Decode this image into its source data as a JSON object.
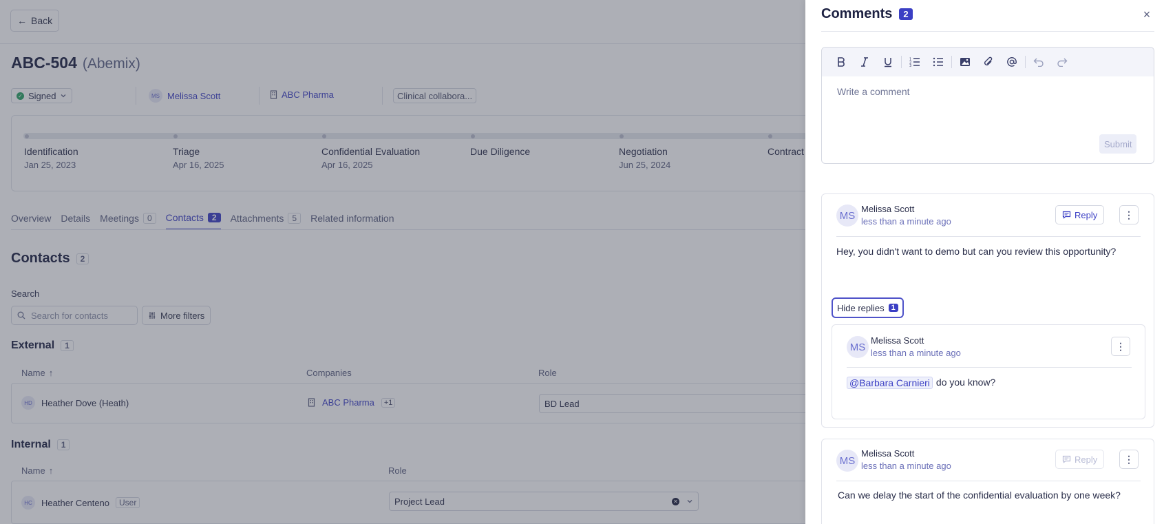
{
  "header": {
    "back_label": "Back",
    "record_id": "ABC-504",
    "record_name": "(Abemix)",
    "status": "Signed",
    "owner_initials": "MS",
    "owner": "Melissa Scott",
    "company": "ABC Pharma",
    "tag": "Clinical collabora..."
  },
  "stages": [
    {
      "name": "Identification",
      "date": "Jan 25, 2023"
    },
    {
      "name": "Triage",
      "date": "Apr 16, 2025"
    },
    {
      "name": "Confidential Evaluation",
      "date": "Apr 16, 2025"
    },
    {
      "name": "Due Diligence",
      "date": ""
    },
    {
      "name": "Negotiation",
      "date": "Jun 25, 2024"
    },
    {
      "name": "Contract",
      "date": ""
    }
  ],
  "tabs": [
    {
      "label": "Overview",
      "count": ""
    },
    {
      "label": "Details",
      "count": ""
    },
    {
      "label": "Meetings",
      "count": "0"
    },
    {
      "label": "Contacts",
      "count": "2"
    },
    {
      "label": "Attachments",
      "count": "5"
    },
    {
      "label": "Related information",
      "count": ""
    }
  ],
  "contacts": {
    "title": "Contacts",
    "count": "2",
    "search_label": "Search",
    "search_placeholder": "Search for contacts",
    "more_filters": "More filters",
    "external": {
      "title": "External",
      "count": "1",
      "columns": [
        "Name",
        "Companies",
        "Role"
      ],
      "rows": [
        {
          "initials": "HD",
          "name": "Heather Dove (Heath)",
          "company": "ABC Pharma",
          "extra": "+1",
          "role": "BD Lead"
        }
      ]
    },
    "internal": {
      "title": "Internal",
      "count": "1",
      "columns": [
        "Name",
        "Role"
      ],
      "rows": [
        {
          "initials": "HC",
          "name": "Heather Centeno",
          "badge": "User",
          "role": "Project Lead"
        }
      ]
    }
  },
  "comments_panel": {
    "title": "Comments",
    "count": "2",
    "editor_placeholder": "Write a comment",
    "submit_label": "Submit",
    "comments": [
      {
        "initials": "MS",
        "author": "Melissa Scott",
        "time": "less than a minute ago",
        "reply_label": "Reply",
        "text": "Hey, you didn't want to demo but can you review this opportunity?",
        "hide_replies_label": "Hide replies",
        "replies_count": "1",
        "reply": {
          "initials": "MS",
          "author": "Melissa Scott",
          "time": "less than a minute ago",
          "mention": "@Barbara Carnieri",
          "text": "do you know?"
        }
      },
      {
        "initials": "MS",
        "author": "Melissa Scott",
        "time": "less than a minute ago",
        "reply_label": "Reply",
        "text": "Can we delay the start of the confidential evaluation by one week?"
      }
    ]
  },
  "colors": {
    "accent": "#3b3fc4",
    "status_green": "#2aa264",
    "overlay": "#3c4050"
  }
}
